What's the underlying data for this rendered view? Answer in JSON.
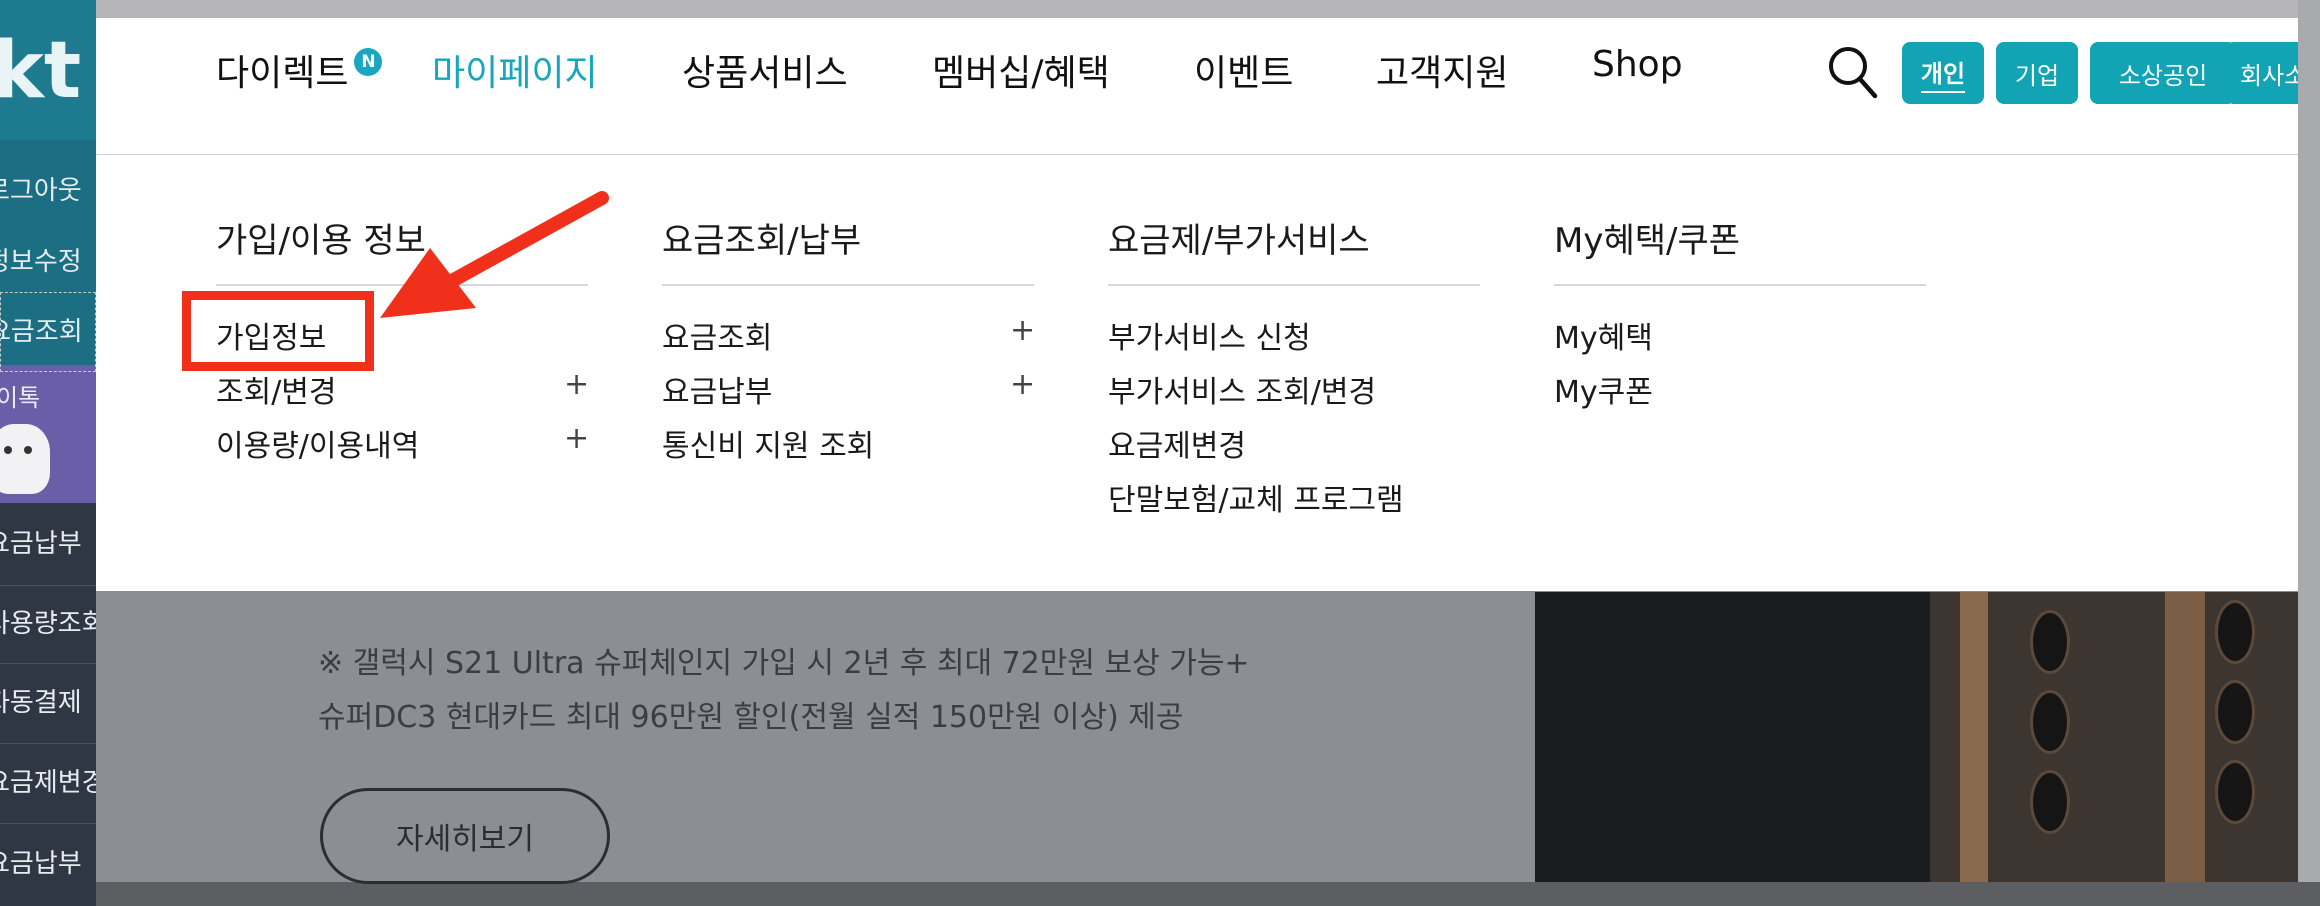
{
  "header": {
    "nav": [
      {
        "label": "다이렉트",
        "badge": "N"
      },
      {
        "label": "마이페이지",
        "active": true
      },
      {
        "label": "상품서비스"
      },
      {
        "label": "멤버십/혜택"
      },
      {
        "label": "이벤트"
      },
      {
        "label": "고객지원"
      },
      {
        "label": "Shop"
      }
    ],
    "segments": [
      {
        "label": "개인",
        "active": true
      },
      {
        "label": "기업"
      },
      {
        "label": "소상공인"
      },
      {
        "label": "회사소개"
      }
    ],
    "icons": {
      "search": "search-icon",
      "menu": "hamburger-menu-icon"
    }
  },
  "megamenu": {
    "columns": [
      {
        "title": "가입/이용 정보",
        "items": [
          {
            "label": "가입정보",
            "expandable": false
          },
          {
            "label": "조회/변경",
            "expandable": true
          },
          {
            "label": "이용량/이용내역",
            "expandable": true
          }
        ]
      },
      {
        "title": "요금조회/납부",
        "items": [
          {
            "label": "요금조회",
            "expandable": true
          },
          {
            "label": "요금납부",
            "expandable": true
          },
          {
            "label": "통신비 지원 조회",
            "expandable": false
          }
        ]
      },
      {
        "title": "요금제/부가서비스",
        "items": [
          {
            "label": "부가서비스 신청",
            "expandable": false
          },
          {
            "label": "부가서비스 조회/변경",
            "expandable": false
          },
          {
            "label": "요금제변경",
            "expandable": false
          },
          {
            "label": "단말보험/교체 프로그램",
            "expandable": false
          }
        ]
      },
      {
        "title": "My혜택/쿠폰",
        "items": [
          {
            "label": "My혜택",
            "expandable": false
          },
          {
            "label": "My쿠폰",
            "expandable": false
          }
        ]
      }
    ],
    "plus_symbol": "+"
  },
  "sidebar": {
    "logo": "kt",
    "items_top": [
      "로그아웃",
      "정보수정",
      "요금조회"
    ],
    "ad_title": "이톡",
    "items_bottom": [
      "요금납부",
      "사용량조회",
      "자동결제",
      "요금제변경",
      "요금납부"
    ]
  },
  "background": {
    "promo_line1": "※ 갤럭시 S21 Ultra 슈퍼체인지 가입 시 2년 후 최대 72만원 보상 가능+",
    "promo_line2": "슈퍼DC3 현대카드 최대 96만원 할인(전월 실적 150만원 이상) 제공",
    "detail_button": "자세히보기"
  },
  "annotation": {
    "color": "#f0301a"
  }
}
